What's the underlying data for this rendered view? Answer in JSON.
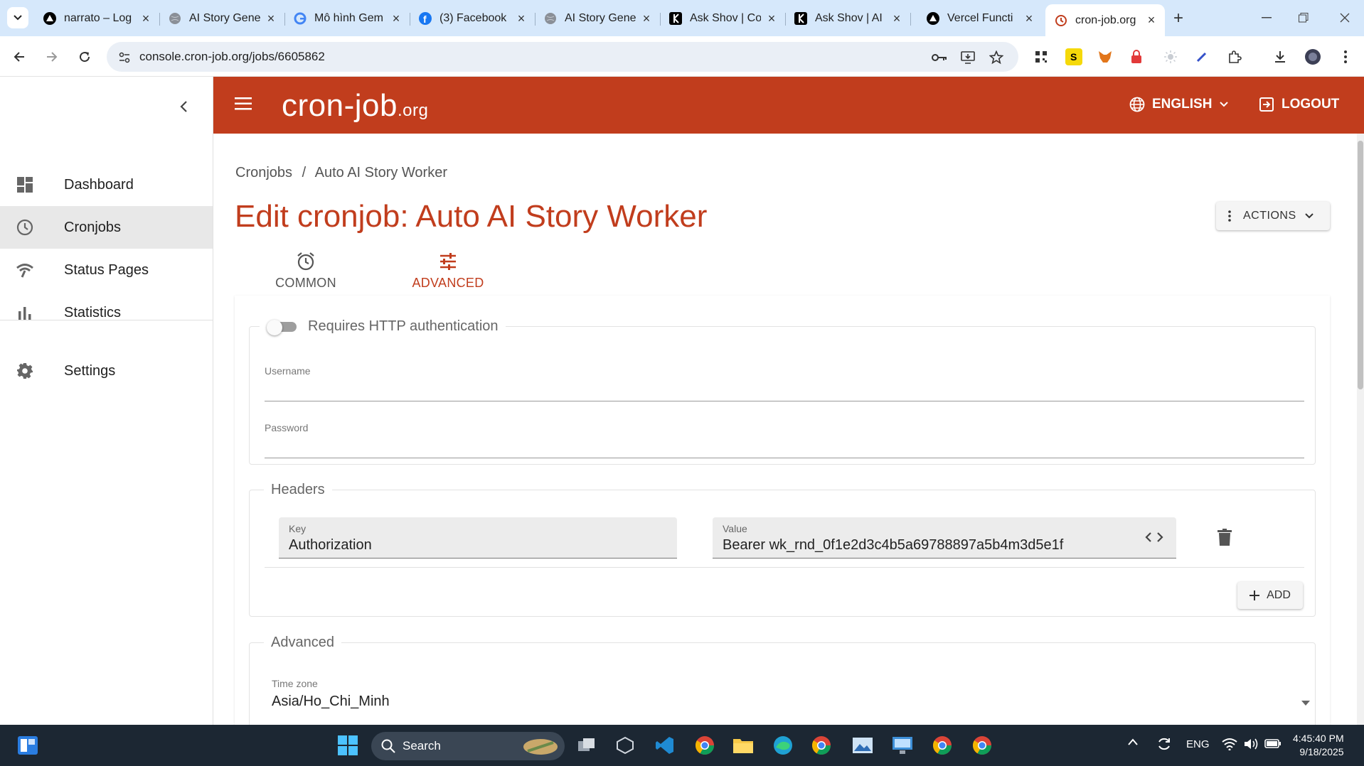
{
  "browser": {
    "tabs": [
      {
        "title": "narrato – Log",
        "icon": "vercel-icon"
      },
      {
        "title": "AI Story Gene",
        "icon": "globe-icon"
      },
      {
        "title": "Mô hình Gem",
        "icon": "google-icon"
      },
      {
        "title": "(3) Facebook",
        "icon": "facebook-icon"
      },
      {
        "title": "AI Story Gene",
        "icon": "globe-icon"
      },
      {
        "title": "Ask Shov | Co",
        "icon": "kwords-icon"
      },
      {
        "title": "Ask Shov | AI",
        "icon": "kwords-icon"
      },
      {
        "title": "Vercel Functi",
        "icon": "vercel-icon"
      },
      {
        "title": "cron-job.org",
        "icon": "cronjob-icon",
        "active": true
      }
    ],
    "url": "console.cron-job.org/jobs/6605862"
  },
  "sidebar": {
    "items": [
      {
        "label": "Dashboard",
        "icon": "dashboard-icon"
      },
      {
        "label": "Cronjobs",
        "icon": "clock-icon",
        "selected": true
      },
      {
        "label": "Status Pages",
        "icon": "signal-icon"
      },
      {
        "label": "Statistics",
        "icon": "bar-chart-icon"
      },
      {
        "label": "Settings",
        "icon": "gear-icon"
      }
    ]
  },
  "appbar": {
    "logo_main": "cron-job",
    "logo_suffix": ".org",
    "language": "ENGLISH",
    "logout": "LOGOUT"
  },
  "breadcrumb": {
    "parent": "Cronjobs",
    "separator": "/",
    "current": "Auto AI Story Worker"
  },
  "page": {
    "title": "Edit cronjob: Auto AI Story Worker",
    "actions_label": "ACTIONS",
    "tabs": [
      {
        "label": "COMMON",
        "icon": "alarm-icon"
      },
      {
        "label": "ADVANCED",
        "icon": "tune-icon",
        "active": true
      }
    ]
  },
  "auth": {
    "toggle_label": "Requires HTTP authentication",
    "enabled": false,
    "username_label": "Username",
    "username_value": "",
    "password_label": "Password",
    "password_value": ""
  },
  "headers": {
    "legend": "Headers",
    "rows": [
      {
        "key_label": "Key",
        "key": "Authorization",
        "value_label": "Value",
        "value": "Bearer wk_rnd_0f1e2d3c4b5a69788897a5b4m3d5e1f"
      }
    ],
    "add_label": "ADD"
  },
  "advanced": {
    "legend": "Advanced",
    "timezone_label": "Time zone",
    "timezone_value": "Asia/Ho_Chi_Minh"
  },
  "taskbar": {
    "search_placeholder": "Search",
    "language": "ENG",
    "time": "4:45:40 PM",
    "date": "9/18/2025"
  },
  "colors": {
    "brand": "#c13d1d",
    "tabstrip": "#d6e8fb",
    "taskbar": "#1c2733"
  }
}
